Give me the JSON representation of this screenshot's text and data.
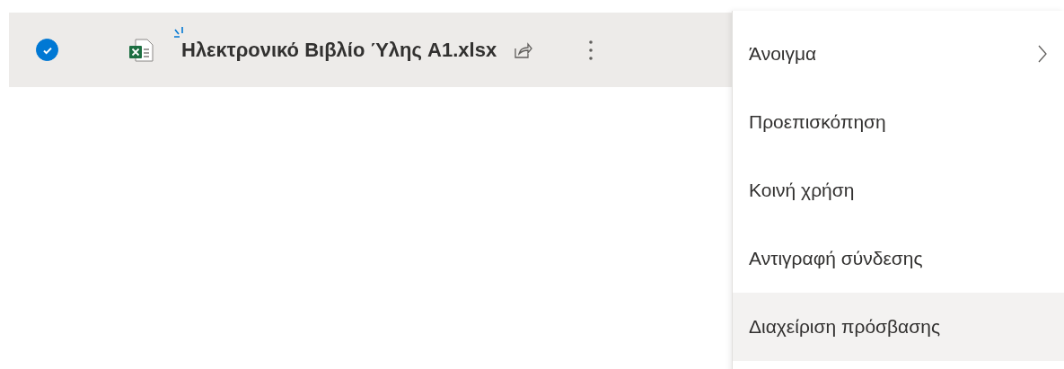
{
  "file_row": {
    "checked": true,
    "name": "Ηλεκτρονικό Βιβλίο Ύλης A1.xlsx",
    "is_new": true
  },
  "context_menu": {
    "items": [
      {
        "label": "Άνοιγμα",
        "has_submenu": true,
        "selected": false
      },
      {
        "label": "Προεπισκόπηση",
        "has_submenu": false,
        "selected": false
      },
      {
        "label": "Κοινή χρήση",
        "has_submenu": false,
        "selected": false
      },
      {
        "label": "Αντιγραφή σύνδεσης",
        "has_submenu": false,
        "selected": false
      },
      {
        "label": "Διαχείριση πρόσβασης",
        "has_submenu": false,
        "selected": true
      }
    ]
  }
}
